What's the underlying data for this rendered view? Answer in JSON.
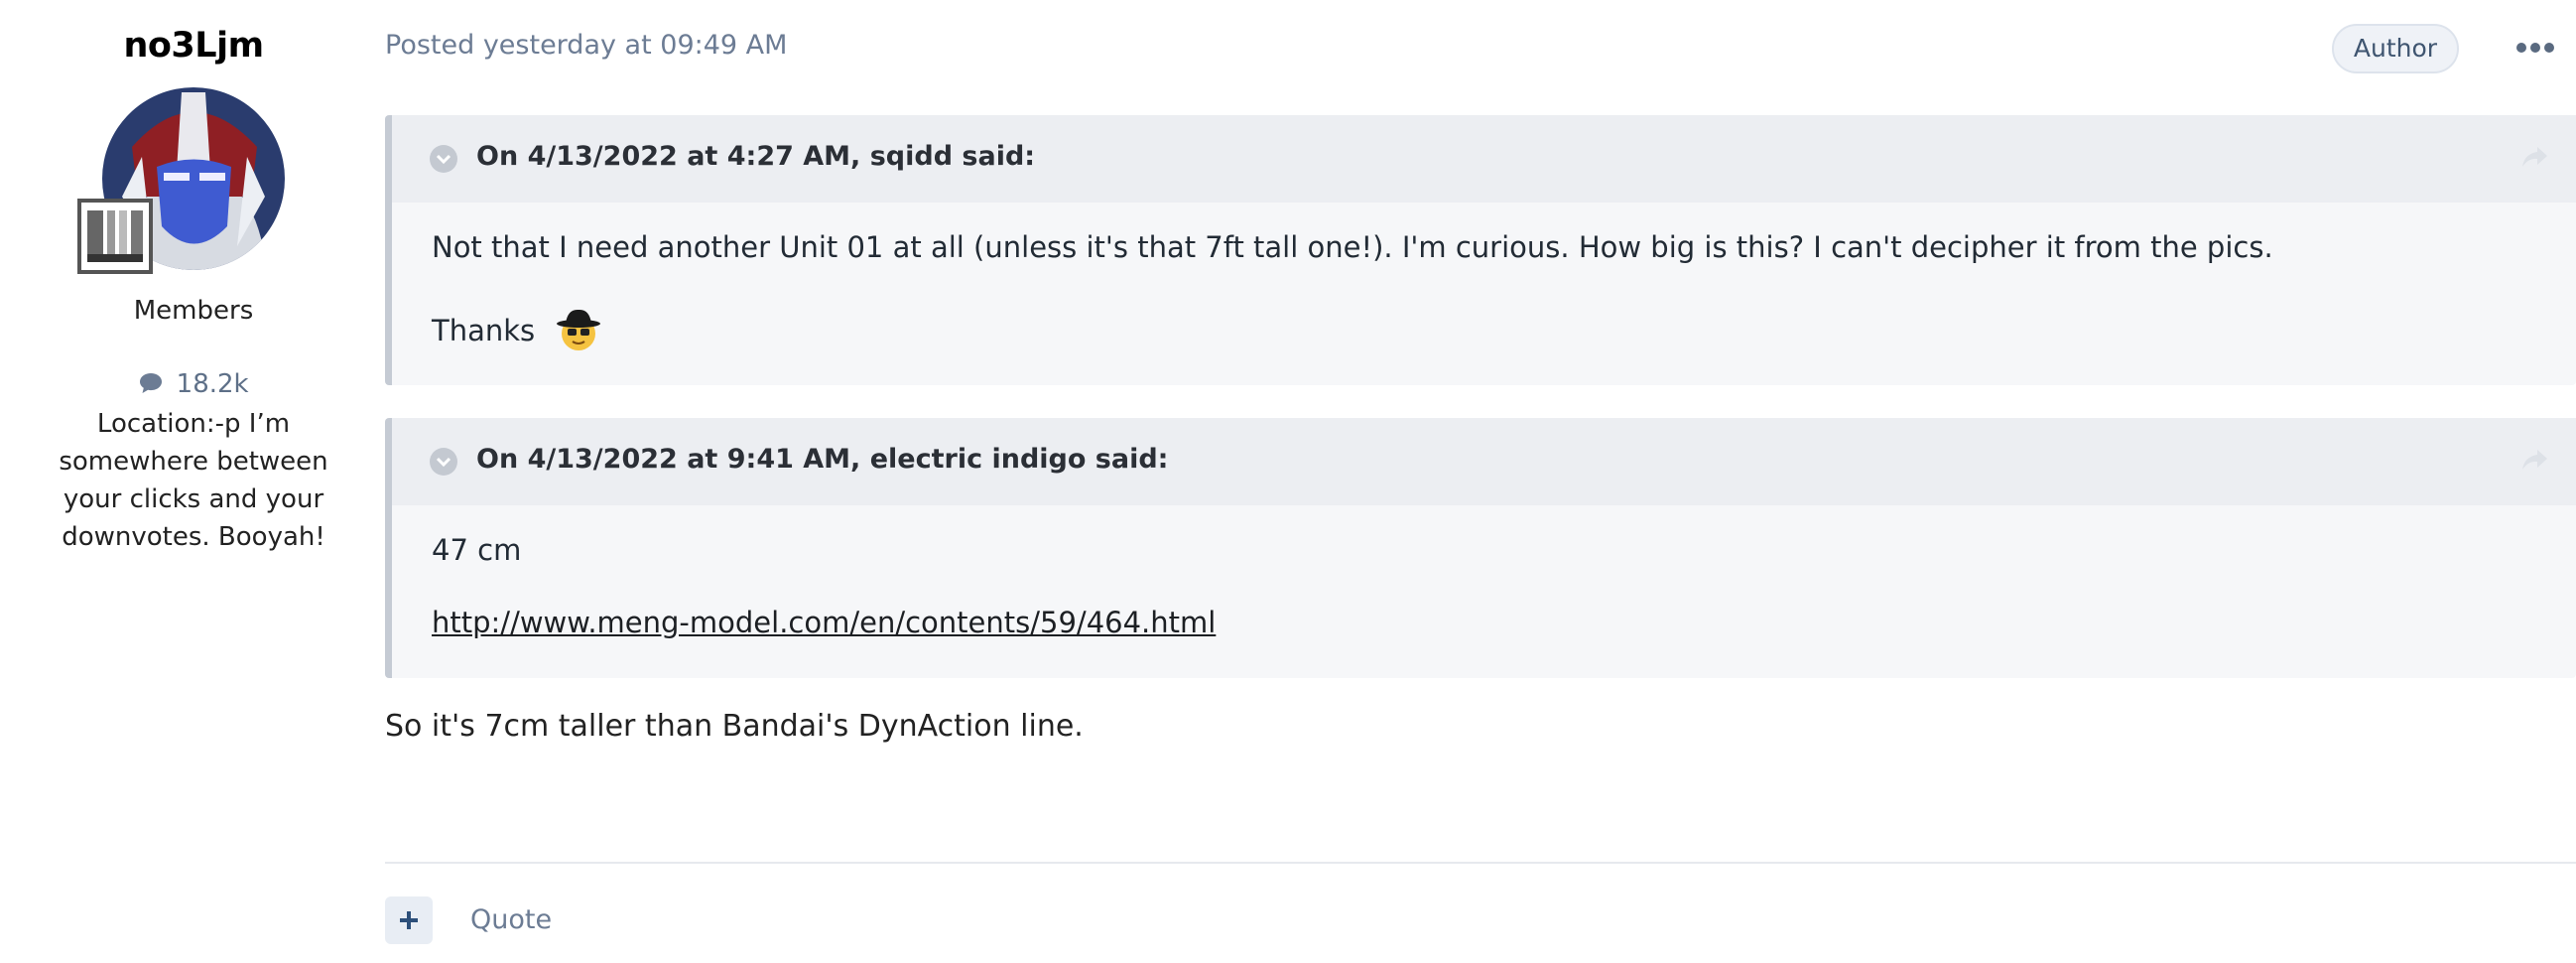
{
  "author": {
    "username": "no3Ljm",
    "group": "Members",
    "post_count": "18.2k",
    "location": "Location:-p I’m somewhere between your clicks and your downvotes. Booyah!"
  },
  "post": {
    "meta": "Posted yesterday at 09:49 AM",
    "author_badge": "Author",
    "quotes": [
      {
        "citation": "On 4/13/2022 at 4:27 AM, sqidd said:",
        "paragraphs": [
          "Not that I need another Unit 01 at all (unless it's that 7ft tall one!). I'm curious. How big is this? I can't decipher it from the pics.",
          "Thanks"
        ]
      },
      {
        "citation": "On 4/13/2022 at 9:41 AM, electric indigo said:",
        "paragraphs": [
          "47 cm",
          "http://www.meng-model.com/en/contents/59/464.html"
        ]
      }
    ],
    "reply": "So it's 7cm taller than Bandai's DynAction line.",
    "actions": {
      "quote_label": "Quote"
    }
  },
  "icons": {
    "comment": "comment-icon",
    "more": "ellipsis-icon",
    "toggle": "chevron-down-icon",
    "share": "share-arrow-icon",
    "plus": "plus-icon"
  },
  "colors": {
    "meta": "#6c7c94",
    "quote_bg": "#f6f7f9",
    "quote_head_bg": "#eceef2",
    "quote_border": "#c5cbd4",
    "badge_bg": "#eff2f7"
  }
}
